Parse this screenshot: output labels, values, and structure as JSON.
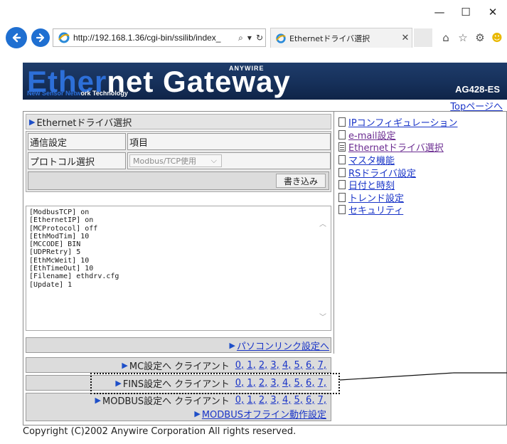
{
  "browser": {
    "address_url": "http://192.168.1.36/cgi-bin/ssilib/index_",
    "tab_title": "Ethernetドライバ選択",
    "win_minimize": "—",
    "win_maximize": "☐",
    "win_close": "✕",
    "icons": [
      "back-arrow-icon",
      "forward-arrow-icon",
      "ie-icon",
      "search-icon",
      "refresh-icon",
      "home-icon",
      "star-icon",
      "gear-icon",
      "smiley-icon"
    ]
  },
  "banner": {
    "word1": "Ether",
    "word2": "net Gateway",
    "brand": "ANYWIRE",
    "sub1": "New Sensor Netw",
    "sub2": "ork Technology",
    "model": "AG428-ES"
  },
  "top_link": "Topページへ",
  "section_title": "Ethernetドライバ選択",
  "form": {
    "header_label": "通信設定",
    "header_value": "項目",
    "protocol_label": "プロトコル選択",
    "protocol_selected": "Modbus/TCP使用",
    "write_button": "書き込み"
  },
  "config_lines": [
    "[ModbusTCP] on",
    "[EthernetIP] on",
    "[MCProtocol] off",
    "[EthModTim] 10",
    "[MCCODE] BIN",
    "[UDPRetry] 5",
    "[EthMcWeit] 10",
    "[EthTimeOut] 10",
    "[Filename] ethdrv.cfg",
    "[Update] 1"
  ],
  "links": {
    "pc_link": "パソコンリンク設定へ",
    "mc_text": "MC設定へ クライアント",
    "fins_text": "FINS設定へ クライアント",
    "modbus_text": "MODBUS設定へ クライアント",
    "modbus_offline": "MODBUSオフライン動作設定",
    "client_numbers": [
      "0,",
      "1,",
      "2,",
      "3,",
      "4,",
      "5,",
      "6,",
      "7,"
    ]
  },
  "menu": [
    {
      "label": "IPコンフィギュレーション",
      "visited": false,
      "selected": false
    },
    {
      "label": "e-mail設定",
      "visited": true,
      "selected": false
    },
    {
      "label": "Ethernetドライバ選択",
      "visited": true,
      "selected": true
    },
    {
      "label": "マスタ機能",
      "visited": false,
      "selected": false
    },
    {
      "label": "RSドライバ設定",
      "visited": false,
      "selected": false
    },
    {
      "label": "日付と時刻",
      "visited": false,
      "selected": false
    },
    {
      "label": "トレンド設定",
      "visited": false,
      "selected": false
    },
    {
      "label": "セキュリティ",
      "visited": false,
      "selected": false
    }
  ],
  "copyright": "Copyright (C)2002 Anywire Corporation All rights reserved."
}
